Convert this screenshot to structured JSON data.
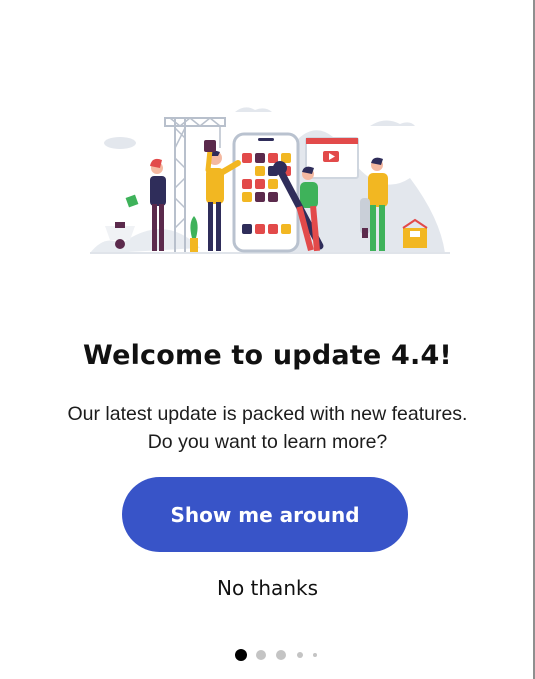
{
  "dialog": {
    "title": "Welcome to update 4.4!",
    "message_line1": "Our latest update is packed with new features.",
    "message_line2": "Do you want to learn more?",
    "primary_button": "Show me around",
    "secondary_button": "No thanks"
  },
  "pagination": {
    "total_pages": 5,
    "current_page": 1
  },
  "colors": {
    "accent": "#3854c8",
    "app_tile_red": "#e24a4a",
    "app_tile_yellow": "#f2b722",
    "app_tile_purple": "#5b2a4c",
    "app_tile_navy": "#2f2d5a"
  },
  "illustration": {
    "icon": "team-building-app-illustration"
  }
}
